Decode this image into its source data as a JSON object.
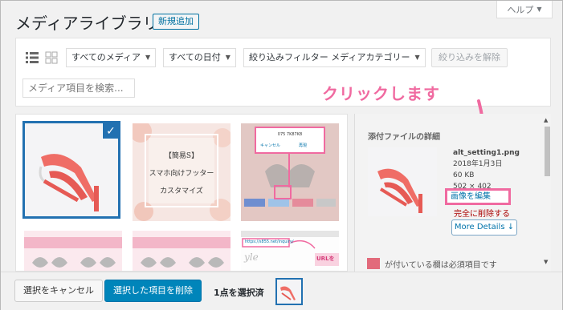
{
  "header": {
    "title": "メディアライブラリ",
    "add_new_label": "新規追加",
    "help_label": "ヘルプ"
  },
  "toolbar": {
    "filter_media": "すべてのメディア",
    "filter_date": "すべての日付",
    "filter_category": "絞り込みフィルター メディアカテゴリー",
    "filter_button": "絞り込みを解除",
    "search_placeholder": "メディア項目を検索..."
  },
  "annotation": {
    "click_text": "クリックします"
  },
  "grid": {
    "thumb2": {
      "line1": "【簡易S】",
      "line2": "スマホ向けフッター",
      "line3": "カスタマイズ"
    },
    "thumb3": {
      "code": "075 7K87K8",
      "cancel": "キャンセル",
      "ok": "再現"
    },
    "thumb6": {
      "url": "https://s855.net/inquiry/",
      "urlnote": "URLを"
    }
  },
  "details": {
    "title": "添付ファイルの詳細",
    "filename": "alt_setting1.png",
    "date": "2018年1月3日",
    "size": "60 KB",
    "dimensions": "502 × 402",
    "edit_link": "画像を編集",
    "delete_link": "完全に削除する",
    "more_details": "More Details ↓",
    "alt_text": "が付いている欄は必須項目です"
  },
  "footer": {
    "cancel_selection": "選択をキャンセル",
    "delete_selected": "選択した項目を削除",
    "count": "1点を選択済"
  },
  "colors": {
    "accent_blue": "#2271b1",
    "annotation_pink": "#f06aa0",
    "primary_button": "#0085ba"
  }
}
